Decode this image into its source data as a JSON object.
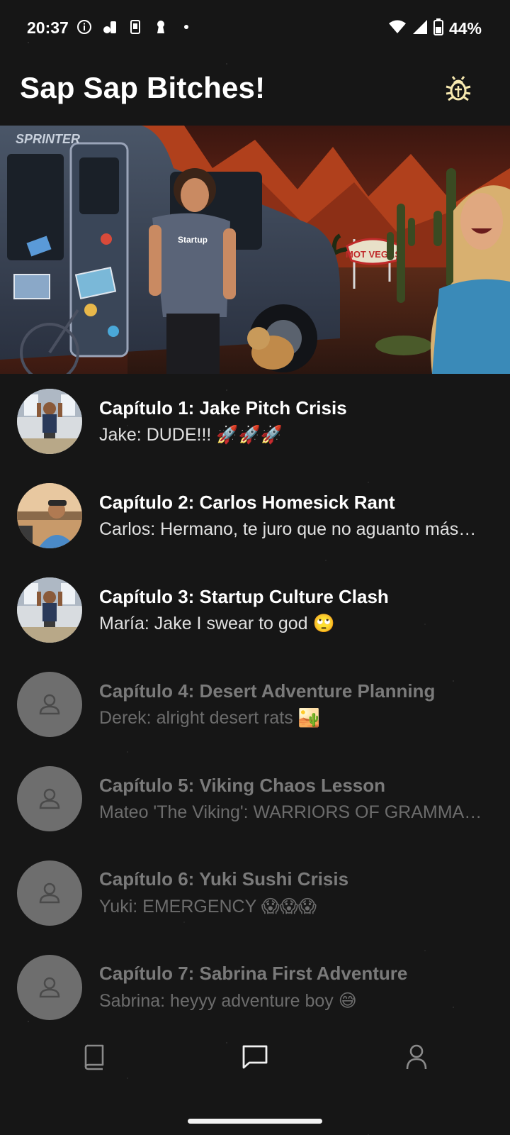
{
  "status_bar": {
    "time": "20:37",
    "battery": "44%"
  },
  "header": {
    "title": "Sap Sap Bitches!",
    "action_icon": "bug-icon"
  },
  "banner": {
    "van_text": "SPRINTER",
    "shirt_text": "Startup",
    "sign_text": "MOT VEGAS"
  },
  "chapters": [
    {
      "title": "Capítulo 1: Jake Pitch Crisis",
      "preview": "Jake: DUDE!!! 🚀🚀🚀",
      "locked": false
    },
    {
      "title": "Capítulo 2: Carlos Homesick Rant",
      "preview": "Carlos: Hermano, te juro que no aguanto más…",
      "locked": false
    },
    {
      "title": "Capítulo 3: Startup Culture Clash",
      "preview": "María: Jake I swear to god 🙄",
      "locked": false
    },
    {
      "title": "Capítulo 4: Desert Adventure Planning",
      "preview": "Derek: alright desert rats 🏜️",
      "locked": true
    },
    {
      "title": "Capítulo 5: Viking Chaos Lesson",
      "preview": "Mateo 'The Viking': WARRIORS OF GRAMMAR…",
      "locked": true
    },
    {
      "title": "Capítulo 6: Yuki Sushi Crisis",
      "preview": "Yuki: EMERGENCY 😱😱😱",
      "locked": true
    },
    {
      "title": "Capítulo 7: Sabrina First Adventure",
      "preview": "Sabrina: heyyy adventure boy 😅",
      "locked": true
    }
  ],
  "bottom_nav": {
    "items": [
      "book-icon",
      "chat-icon",
      "profile-icon"
    ],
    "active": "chat-icon"
  }
}
